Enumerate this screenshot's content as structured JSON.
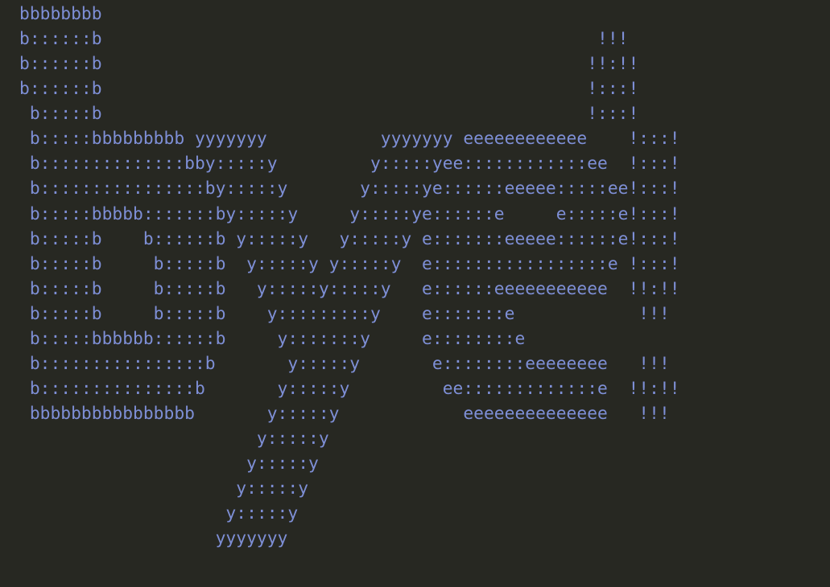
{
  "terminal": {
    "text_color": "#7e8fd6",
    "background_color": "#272822",
    "ascii_art_lines": [
      "bbbbbbbb",
      "b::::::b                                                !!!",
      "b::::::b                                               !!:!!",
      "b::::::b                                               !:::!",
      " b:::::b                                               !:::!",
      " b:::::bbbbbbbbb yyyyyyy           yyyyyyy eeeeeeeeeeee    !:::!",
      " b::::::::::::::bby:::::y         y:::::yee::::::::::::ee  !:::!",
      " b::::::::::::::::by:::::y       y:::::ye::::::eeeee:::::ee!:::!",
      " b:::::bbbbb:::::::by:::::y     y:::::ye::::::e     e:::::e!:::!",
      " b:::::b    b::::::b y:::::y   y:::::y e:::::::eeeee::::::e!:::!",
      " b:::::b     b:::::b  y:::::y y:::::y  e:::::::::::::::::e !:::!",
      " b:::::b     b:::::b   y:::::y:::::y   e::::::eeeeeeeeeee  !!:!!",
      " b:::::b     b:::::b    y:::::::::y    e:::::::e            !!!",
      " b:::::bbbbbb::::::b     y:::::::y     e::::::::e",
      " b::::::::::::::::b       y:::::y       e::::::::eeeeeeee   !!!",
      " b:::::::::::::::b       y:::::y         ee:::::::::::::e  !!:!!",
      " bbbbbbbbbbbbbbbb       y:::::y            eeeeeeeeeeeeee   !!!",
      "                       y:::::y",
      "                      y:::::y",
      "                     y:::::y",
      "                    y:::::y",
      "                   yyyyyyy"
    ]
  }
}
